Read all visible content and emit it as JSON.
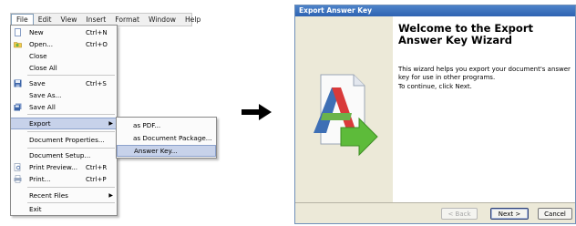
{
  "menubar": {
    "items": [
      "File",
      "Edit",
      "View",
      "Insert",
      "Format",
      "Window",
      "Help"
    ]
  },
  "file_menu": {
    "new": {
      "label": "New",
      "shortcut": "Ctrl+N"
    },
    "open": {
      "label": "Open...",
      "shortcut": "Ctrl+O"
    },
    "close": {
      "label": "Close"
    },
    "close_all": {
      "label": "Close All"
    },
    "save": {
      "label": "Save",
      "shortcut": "Ctrl+S"
    },
    "save_as": {
      "label": "Save As..."
    },
    "save_all": {
      "label": "Save All"
    },
    "export": {
      "label": "Export"
    },
    "document_properties": {
      "label": "Document Properties..."
    },
    "document_setup": {
      "label": "Document Setup..."
    },
    "print_preview": {
      "label": "Print Preview...",
      "shortcut": "Ctrl+R"
    },
    "print": {
      "label": "Print...",
      "shortcut": "Ctrl+P"
    },
    "recent_files": {
      "label": "Recent Files"
    },
    "exit": {
      "label": "Exit"
    }
  },
  "export_submenu": {
    "as_pdf": "as PDF...",
    "as_document_package": "as Document Package...",
    "answer_key": "Answer Key..."
  },
  "wizard": {
    "window_title": "Export Answer Key",
    "heading": "Welcome to the Export Answer Key Wizard",
    "intro": "This wizard helps you export your document's answer key for use in other programs.",
    "instruction": "To continue, click Next.",
    "back_label": "< Back",
    "next_label": "Next >",
    "cancel_label": "Cancel"
  },
  "colors": {
    "menu_highlight": "#c7d2ea",
    "wizard_titlebar": "#2e63b2",
    "wizard_side": "#ece9d8"
  }
}
